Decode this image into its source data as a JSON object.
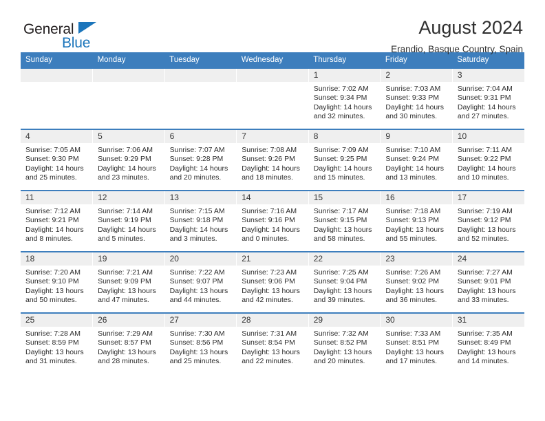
{
  "brand": {
    "name_top": "General",
    "name_bottom": "Blue",
    "accent_color": "#1b75bb"
  },
  "header": {
    "title": "August 2024",
    "subtitle": "Erandio, Basque Country, Spain"
  },
  "theme": {
    "header_row_bg": "#3d7ebd",
    "daynum_bg": "#efefef",
    "text_color": "#2c2c2c"
  },
  "weekdays": [
    "Sunday",
    "Monday",
    "Tuesday",
    "Wednesday",
    "Thursday",
    "Friday",
    "Saturday"
  ],
  "labels": {
    "sunrise_prefix": "Sunrise:",
    "sunset_prefix": "Sunset:",
    "daylight_prefix": "Daylight:"
  },
  "weeks": [
    [
      {
        "day": "",
        "empty": true
      },
      {
        "day": "",
        "empty": true
      },
      {
        "day": "",
        "empty": true
      },
      {
        "day": "",
        "empty": true
      },
      {
        "day": "1",
        "sunrise": "Sunrise: 7:02 AM",
        "sunset": "Sunset: 9:34 PM",
        "daylight_1": "Daylight: 14 hours",
        "daylight_2": "and 32 minutes."
      },
      {
        "day": "2",
        "sunrise": "Sunrise: 7:03 AM",
        "sunset": "Sunset: 9:33 PM",
        "daylight_1": "Daylight: 14 hours",
        "daylight_2": "and 30 minutes."
      },
      {
        "day": "3",
        "sunrise": "Sunrise: 7:04 AM",
        "sunset": "Sunset: 9:31 PM",
        "daylight_1": "Daylight: 14 hours",
        "daylight_2": "and 27 minutes."
      }
    ],
    [
      {
        "day": "4",
        "sunrise": "Sunrise: 7:05 AM",
        "sunset": "Sunset: 9:30 PM",
        "daylight_1": "Daylight: 14 hours",
        "daylight_2": "and 25 minutes."
      },
      {
        "day": "5",
        "sunrise": "Sunrise: 7:06 AM",
        "sunset": "Sunset: 9:29 PM",
        "daylight_1": "Daylight: 14 hours",
        "daylight_2": "and 23 minutes."
      },
      {
        "day": "6",
        "sunrise": "Sunrise: 7:07 AM",
        "sunset": "Sunset: 9:28 PM",
        "daylight_1": "Daylight: 14 hours",
        "daylight_2": "and 20 minutes."
      },
      {
        "day": "7",
        "sunrise": "Sunrise: 7:08 AM",
        "sunset": "Sunset: 9:26 PM",
        "daylight_1": "Daylight: 14 hours",
        "daylight_2": "and 18 minutes."
      },
      {
        "day": "8",
        "sunrise": "Sunrise: 7:09 AM",
        "sunset": "Sunset: 9:25 PM",
        "daylight_1": "Daylight: 14 hours",
        "daylight_2": "and 15 minutes."
      },
      {
        "day": "9",
        "sunrise": "Sunrise: 7:10 AM",
        "sunset": "Sunset: 9:24 PM",
        "daylight_1": "Daylight: 14 hours",
        "daylight_2": "and 13 minutes."
      },
      {
        "day": "10",
        "sunrise": "Sunrise: 7:11 AM",
        "sunset": "Sunset: 9:22 PM",
        "daylight_1": "Daylight: 14 hours",
        "daylight_2": "and 10 minutes."
      }
    ],
    [
      {
        "day": "11",
        "sunrise": "Sunrise: 7:12 AM",
        "sunset": "Sunset: 9:21 PM",
        "daylight_1": "Daylight: 14 hours",
        "daylight_2": "and 8 minutes."
      },
      {
        "day": "12",
        "sunrise": "Sunrise: 7:14 AM",
        "sunset": "Sunset: 9:19 PM",
        "daylight_1": "Daylight: 14 hours",
        "daylight_2": "and 5 minutes."
      },
      {
        "day": "13",
        "sunrise": "Sunrise: 7:15 AM",
        "sunset": "Sunset: 9:18 PM",
        "daylight_1": "Daylight: 14 hours",
        "daylight_2": "and 3 minutes."
      },
      {
        "day": "14",
        "sunrise": "Sunrise: 7:16 AM",
        "sunset": "Sunset: 9:16 PM",
        "daylight_1": "Daylight: 14 hours",
        "daylight_2": "and 0 minutes."
      },
      {
        "day": "15",
        "sunrise": "Sunrise: 7:17 AM",
        "sunset": "Sunset: 9:15 PM",
        "daylight_1": "Daylight: 13 hours",
        "daylight_2": "and 58 minutes."
      },
      {
        "day": "16",
        "sunrise": "Sunrise: 7:18 AM",
        "sunset": "Sunset: 9:13 PM",
        "daylight_1": "Daylight: 13 hours",
        "daylight_2": "and 55 minutes."
      },
      {
        "day": "17",
        "sunrise": "Sunrise: 7:19 AM",
        "sunset": "Sunset: 9:12 PM",
        "daylight_1": "Daylight: 13 hours",
        "daylight_2": "and 52 minutes."
      }
    ],
    [
      {
        "day": "18",
        "sunrise": "Sunrise: 7:20 AM",
        "sunset": "Sunset: 9:10 PM",
        "daylight_1": "Daylight: 13 hours",
        "daylight_2": "and 50 minutes."
      },
      {
        "day": "19",
        "sunrise": "Sunrise: 7:21 AM",
        "sunset": "Sunset: 9:09 PM",
        "daylight_1": "Daylight: 13 hours",
        "daylight_2": "and 47 minutes."
      },
      {
        "day": "20",
        "sunrise": "Sunrise: 7:22 AM",
        "sunset": "Sunset: 9:07 PM",
        "daylight_1": "Daylight: 13 hours",
        "daylight_2": "and 44 minutes."
      },
      {
        "day": "21",
        "sunrise": "Sunrise: 7:23 AM",
        "sunset": "Sunset: 9:06 PM",
        "daylight_1": "Daylight: 13 hours",
        "daylight_2": "and 42 minutes."
      },
      {
        "day": "22",
        "sunrise": "Sunrise: 7:25 AM",
        "sunset": "Sunset: 9:04 PM",
        "daylight_1": "Daylight: 13 hours",
        "daylight_2": "and 39 minutes."
      },
      {
        "day": "23",
        "sunrise": "Sunrise: 7:26 AM",
        "sunset": "Sunset: 9:02 PM",
        "daylight_1": "Daylight: 13 hours",
        "daylight_2": "and 36 minutes."
      },
      {
        "day": "24",
        "sunrise": "Sunrise: 7:27 AM",
        "sunset": "Sunset: 9:01 PM",
        "daylight_1": "Daylight: 13 hours",
        "daylight_2": "and 33 minutes."
      }
    ],
    [
      {
        "day": "25",
        "sunrise": "Sunrise: 7:28 AM",
        "sunset": "Sunset: 8:59 PM",
        "daylight_1": "Daylight: 13 hours",
        "daylight_2": "and 31 minutes."
      },
      {
        "day": "26",
        "sunrise": "Sunrise: 7:29 AM",
        "sunset": "Sunset: 8:57 PM",
        "daylight_1": "Daylight: 13 hours",
        "daylight_2": "and 28 minutes."
      },
      {
        "day": "27",
        "sunrise": "Sunrise: 7:30 AM",
        "sunset": "Sunset: 8:56 PM",
        "daylight_1": "Daylight: 13 hours",
        "daylight_2": "and 25 minutes."
      },
      {
        "day": "28",
        "sunrise": "Sunrise: 7:31 AM",
        "sunset": "Sunset: 8:54 PM",
        "daylight_1": "Daylight: 13 hours",
        "daylight_2": "and 22 minutes."
      },
      {
        "day": "29",
        "sunrise": "Sunrise: 7:32 AM",
        "sunset": "Sunset: 8:52 PM",
        "daylight_1": "Daylight: 13 hours",
        "daylight_2": "and 20 minutes."
      },
      {
        "day": "30",
        "sunrise": "Sunrise: 7:33 AM",
        "sunset": "Sunset: 8:51 PM",
        "daylight_1": "Daylight: 13 hours",
        "daylight_2": "and 17 minutes."
      },
      {
        "day": "31",
        "sunrise": "Sunrise: 7:35 AM",
        "sunset": "Sunset: 8:49 PM",
        "daylight_1": "Daylight: 13 hours",
        "daylight_2": "and 14 minutes."
      }
    ]
  ]
}
